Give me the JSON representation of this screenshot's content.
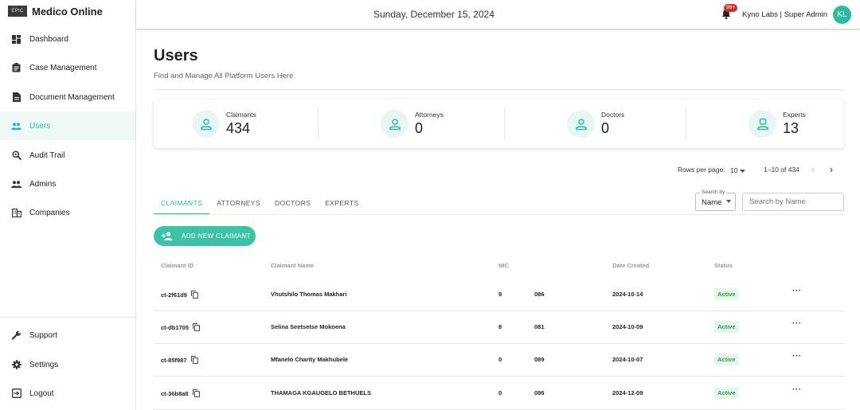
{
  "brand": {
    "logo_text": "EPIC",
    "name": "Medico Online"
  },
  "sidebar": {
    "items": [
      {
        "label": "Dashboard",
        "icon": "dashboard-icon"
      },
      {
        "label": "Case Management",
        "icon": "clipboard-icon"
      },
      {
        "label": "Document Management",
        "icon": "document-icon"
      },
      {
        "label": "Users",
        "icon": "people-icon",
        "active": true
      },
      {
        "label": "Audit Trail",
        "icon": "search-audit-icon"
      },
      {
        "label": "Admins",
        "icon": "people-icon"
      },
      {
        "label": "Companies",
        "icon": "building-icon"
      }
    ],
    "bottom_items": [
      {
        "label": "Support",
        "icon": "wrench-icon"
      },
      {
        "label": "Settings",
        "icon": "gear-icon"
      },
      {
        "label": "Logout",
        "icon": "logout-icon"
      }
    ]
  },
  "header": {
    "date": "Sunday, December 15, 2024",
    "notification_badge": "99+",
    "user_label": "Kyno Labs | Super Admin",
    "avatar_initials": "KL"
  },
  "page": {
    "title": "Users",
    "subtitle": "Find and Manage All Platform Users Here"
  },
  "stats": [
    {
      "label": "Claimants",
      "value": "434"
    },
    {
      "label": "Attorneys",
      "value": "0"
    },
    {
      "label": "Doctors",
      "value": "0"
    },
    {
      "label": "Experts",
      "value": "13"
    }
  ],
  "pagination": {
    "rows_per_page_label": "Rows per page:",
    "rows_per_page": "10",
    "range": "1–10 of 434",
    "prev": "‹",
    "next": "›"
  },
  "tabs": [
    "CLAIMANTS",
    "ATTORNEYS",
    "DOCTORS",
    "EXPERTS"
  ],
  "search": {
    "by_legend": "Search by",
    "by_value": "Name",
    "placeholder": "Search by Name"
  },
  "add_button_label": "ADD NEW CLAIMANT",
  "table": {
    "headers": [
      "Claimant ID",
      "Claimant Name",
      "NIC",
      "Date Created",
      "Status"
    ],
    "rows": [
      {
        "id": "ct-2f61d9",
        "name": "Vhutshilo Thomas Makhari",
        "nic_a": "9",
        "nic_b": "086",
        "date": "2024-10-14",
        "status": "Active",
        "more": "···"
      },
      {
        "id": "ct-db1705",
        "name": "Selina Seetsetse Mokoena",
        "nic_a": "8",
        "nic_b": "081",
        "date": "2024-10-09",
        "status": "Active",
        "more": "···"
      },
      {
        "id": "ct-85f987",
        "name": "Mfanelo Charity Makhubele",
        "nic_a": "0",
        "nic_b": "089",
        "date": "2024-10-07",
        "status": "Active",
        "more": "···"
      },
      {
        "id": "ct-36b8a8",
        "name": "THAMAGA KGAUGELO BETHUELS",
        "nic_a": "0",
        "nic_b": "086",
        "date": "2024-12-09",
        "status": "Active",
        "more": "···"
      }
    ]
  },
  "colors": {
    "accent": "#2bbb9e",
    "active_status": "#2e9e4f",
    "badge": "#d32f2f"
  }
}
